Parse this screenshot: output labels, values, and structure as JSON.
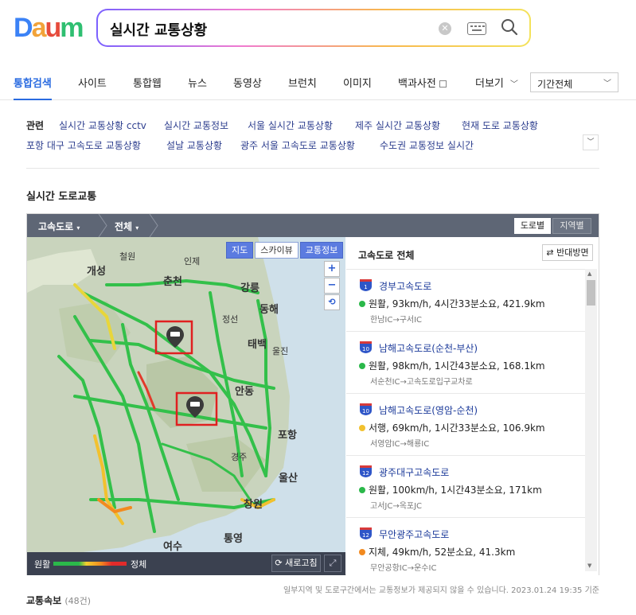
{
  "logo": {
    "letters": [
      "D",
      "a",
      "u",
      "m"
    ]
  },
  "search": {
    "query": "실시간 교통상황"
  },
  "tabs": {
    "items": [
      "통합검색",
      "사이트",
      "통합웹",
      "뉴스",
      "동영상",
      "브런치",
      "이미지",
      "백과사전",
      "더보기"
    ],
    "period": "기간전체"
  },
  "related": {
    "label": "관련",
    "links": [
      "실시간 교통상황 cctv",
      "실시간 교통정보",
      "서울 실시간 교통상황",
      "제주 실시간 교통상황",
      "현재 도로 교통상황",
      "포항 대구 고속도로 교통상황",
      "설날 교통상황",
      "광주 서울 고속도로 교통상황",
      "수도권 교통정보 실시간"
    ]
  },
  "section_title": "실시간 도로교통",
  "traffic": {
    "breadcrumb": [
      "고속도로",
      "전체"
    ],
    "view_toggle": [
      "도로별",
      "지역별"
    ],
    "map_buttons": [
      "지도",
      "스카이뷰",
      "교통정보"
    ],
    "map_labels": [
      "개성",
      "철원",
      "인제",
      "춘천",
      "강릉",
      "동해",
      "정선",
      "태백",
      "울진",
      "안동",
      "포항",
      "울산",
      "창원",
      "통영",
      "여수",
      "경주"
    ],
    "legend": {
      "smooth": "원활",
      "jam": "정체"
    },
    "refresh": "새로고침",
    "panel_title": "고속도로 전체",
    "reverse": "반대방면",
    "highways": [
      {
        "num": "1",
        "name": "경부고속도로",
        "status": "원활, 93km/h, 4시간33분소요, 421.9km",
        "route": "한남IC→구서IC",
        "color": "#2bb84a"
      },
      {
        "num": "10",
        "name": "남해고속도로(순천-부산)",
        "status": "원활, 98km/h, 1시간43분소요, 168.1km",
        "route": "서순천IC→고속도로입구교차로",
        "color": "#2bb84a"
      },
      {
        "num": "10",
        "name": "남해고속도로(영암-순천)",
        "status": "서행, 69km/h, 1시간33분소요, 106.9km",
        "route": "서영암IC→해룡IC",
        "color": "#f2c12e"
      },
      {
        "num": "12",
        "name": "광주대구고속도로",
        "status": "원활, 100km/h, 1시간43분소요, 171km",
        "route": "고서JC→옥포JC",
        "color": "#2bb84a"
      },
      {
        "num": "12",
        "name": "무안광주고속도로",
        "status": "지체, 49km/h, 52분소요, 41.3km",
        "route": "무안공항IC→운수IC",
        "color": "#f28a1f"
      }
    ]
  },
  "note": "일부지역 및 도로구간에서는 교통정보가 제공되지 않을 수 있습니다. 2023.01.24 19:35 기준",
  "alerts": {
    "title": "교통속보",
    "count": "(48건)"
  }
}
